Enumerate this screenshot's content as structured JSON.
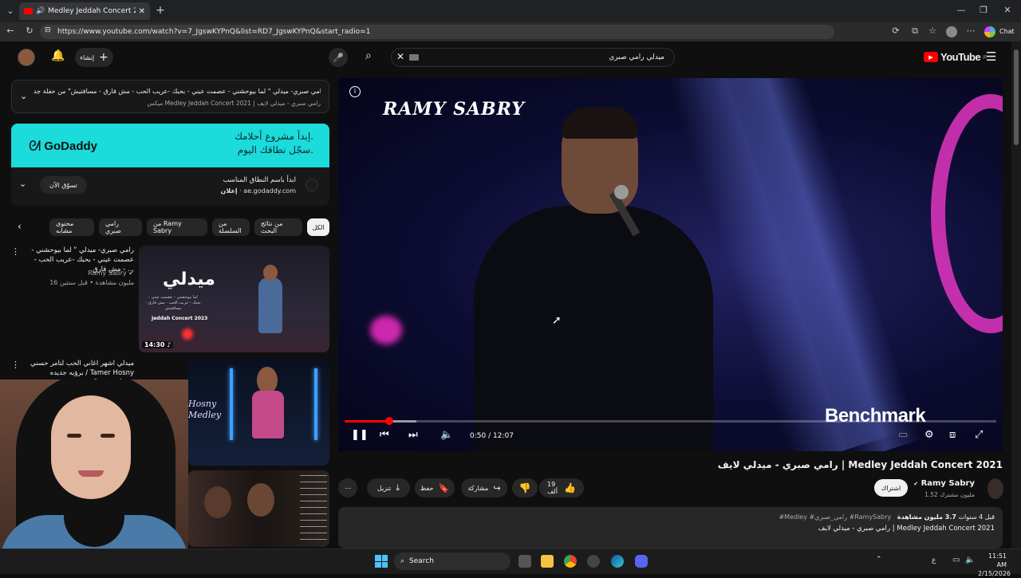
{
  "browser": {
    "tab_title": "Medley Jeddah Concert 2021",
    "url": "https://www.youtube.com/watch?v=7_JgswKYPnQ&list=RD7_JgswKYPnQ&start_radio=1",
    "chat_label": "Chat"
  },
  "masthead": {
    "logo": "YouTube",
    "logo_region": "JO",
    "search_value": "ميدلي رامي صبري",
    "create_label": "إنشاء"
  },
  "mix_header": {
    "title": "التالي: رامي صبري- ميدلي \" لما بيوحشني - عصمت عيني - بحبك -عريب الحب - مش فارق - مسافتيش\" من حفلة جد...",
    "subtitle": "ميكس Medley Jeddah Concert 2021 | رامي صبري - ميدلي لايف"
  },
  "ad": {
    "brand": "GoDaddy",
    "banner_line1": "إبدأ مشروع أحلامك.",
    "banner_line2": "سجّل نطاقك اليوم.",
    "headline": "ابدأ باسم النطاق المناسب",
    "sponsor_label": "إعلان",
    "domain": "ae.godaddy.com",
    "cta": "تسوّق الآن"
  },
  "chips": [
    "الكل",
    "من نتائج البحث",
    "من السلسلة",
    "من Ramy Sabry",
    "رامي صبري",
    "محتوى مشابه"
  ],
  "suggestions": [
    {
      "title": "رامي صبري- ميدلي \" لما بيوحشني - عصمت عيني - بحبك -عريب الحب - مش فارق - ...",
      "channel": "Ramy Sabry",
      "stats": "16 مليون مشاهدة • قبل سنتين",
      "duration": "14:30",
      "thumb_title": "ميدلي",
      "thumb_sub": "Jeddah Concert 2023",
      "thumb_list": "لما بيوحشني - عصمت عيني - بحبك - عريب الحب - مش فارق - مسافتيش"
    },
    {
      "title": "ميدلي اشهر اغاني الحب لتامر حسني برؤيه جديده / Tamer Hosny Romantic ...",
      "thumb_title": "Hosny Medley"
    }
  ],
  "player": {
    "watermark": "RAMY SABRY",
    "sponsor_overlay": "Benchmark",
    "time_current": "0:50",
    "time_total": "12:07",
    "progress": 0.069,
    "buffered": 0.11
  },
  "video": {
    "title": "رامي صبري - ميدلي لايف | Medley Jeddah Concert 2021",
    "channel": "Ramy Sabry",
    "subscribers": "1.52 مليون مشترك",
    "subscribe_label": "اشتراك",
    "likes": "19 ألف",
    "share_label": "مشاركة",
    "save_label": "حفظ",
    "download_label": "تنزيل",
    "views": "3.7 مليون مشاهدة",
    "age": "قبل 4 سنوات",
    "hashtags": "#Medley #رامي_صبري #RamySabry",
    "description": "رامي صبري - ميدلي لايف | Medley Jeddah Concert 2021"
  },
  "taskbar": {
    "search_label": "Search",
    "time": "11:51 AM",
    "date": "2/15/2026",
    "lang": "ع"
  }
}
